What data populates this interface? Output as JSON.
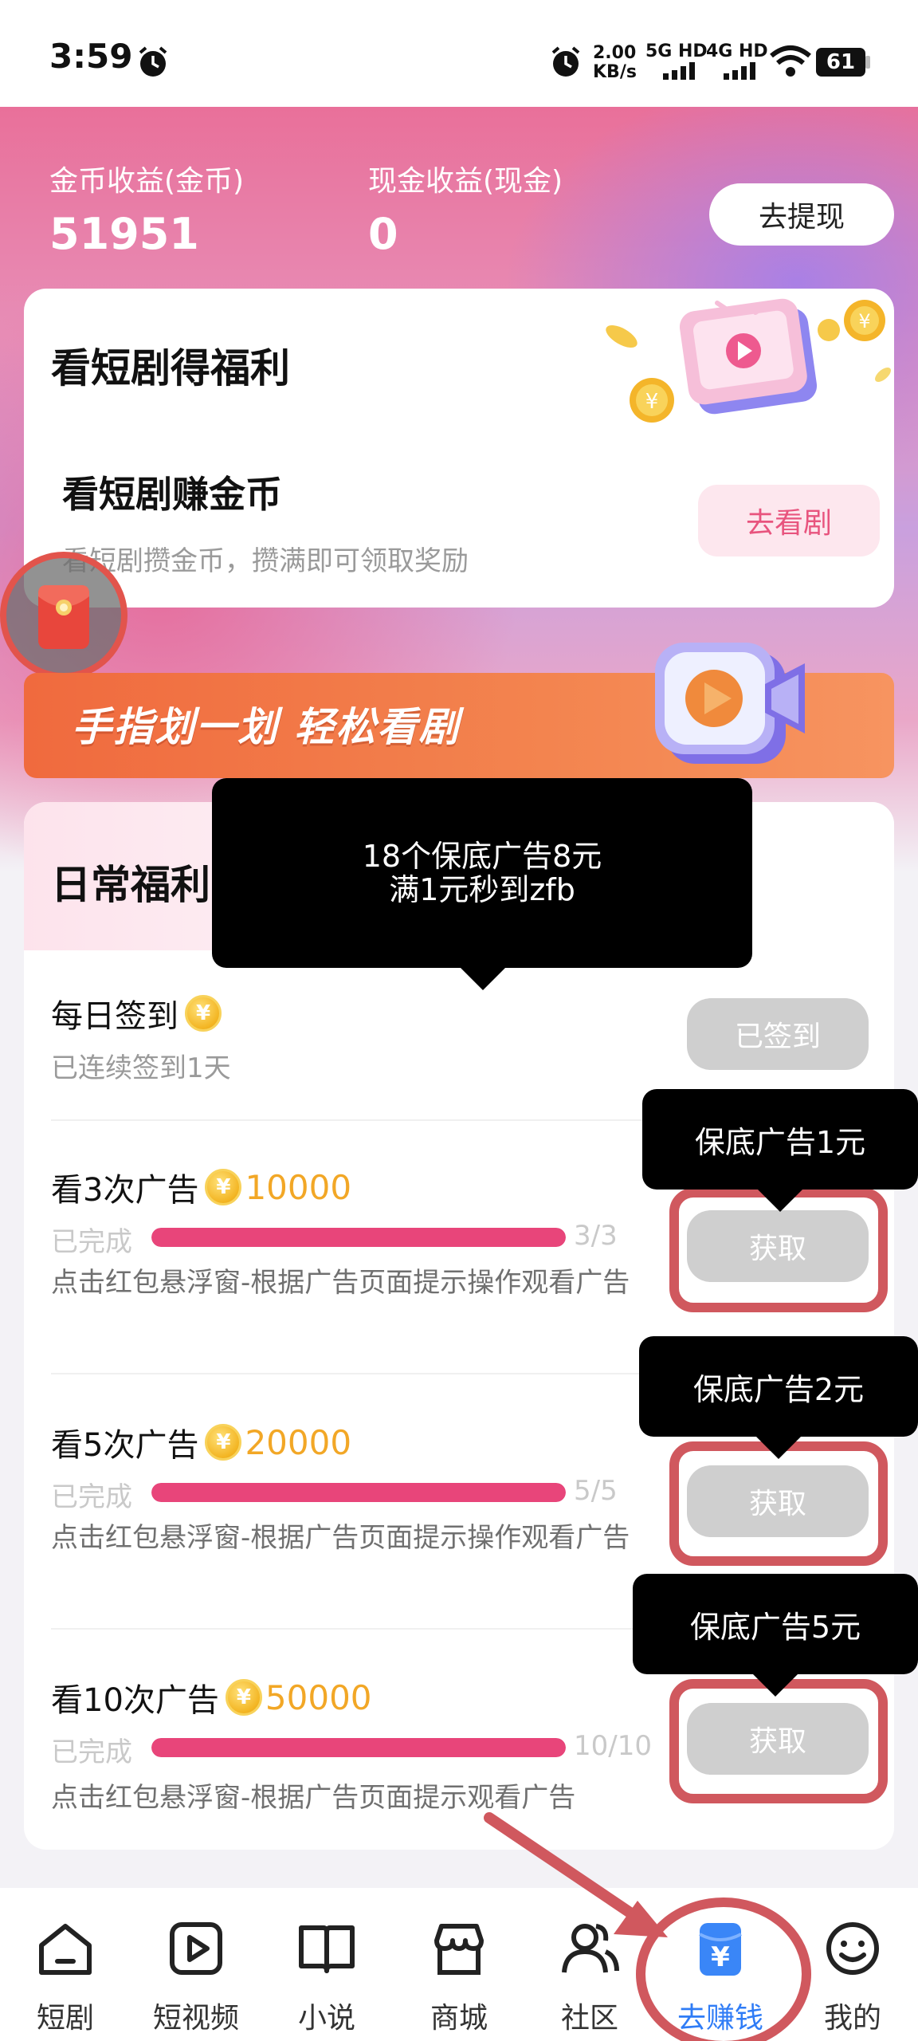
{
  "status_bar": {
    "time": "3:59",
    "net_speed_top": "2.00",
    "net_speed_unit": "KB/s",
    "sim1": "5G HD",
    "sim2": "4G HD",
    "battery": "61"
  },
  "earnings": {
    "coin_label": "金币收益(金币)",
    "coin_value": "51951",
    "cash_label": "现金收益(现金)",
    "cash_value": "0",
    "withdraw_button": "去提现"
  },
  "drama_card": {
    "title": "看短剧得福利",
    "task_title": "看短剧赚金币",
    "task_desc": "看短剧攒金币，攒满即可领取奖励",
    "watch_button": "去看剧"
  },
  "banner": {
    "text": "手指划一划 轻松看剧"
  },
  "tooltips": {
    "main_line1": "18个保底广告8元",
    "main_line2": "满1元秒到zfb",
    "ad1": "保底广告1元",
    "ad2": "保底广告2元",
    "ad3": "保底广告5元"
  },
  "daily": {
    "title": "日常福利",
    "checkin": {
      "title": "每日签到",
      "sub": "已连续签到1天",
      "button": "已签到"
    },
    "tasks": [
      {
        "title": "看3次广告",
        "reward": "10000",
        "status": "已完成",
        "progress": 1.0,
        "count": "3/3",
        "desc": "点击红包悬浮窗-根据广告页面提示操作观看广告",
        "button": "获取"
      },
      {
        "title": "看5次广告",
        "reward": "20000",
        "status": "已完成",
        "progress": 1.0,
        "count": "5/5",
        "desc": "点击红包悬浮窗-根据广告页面提示操作观看广告",
        "button": "获取"
      },
      {
        "title": "看10次广告",
        "reward": "50000",
        "status": "已完成",
        "progress": 1.0,
        "count": "10/10",
        "desc": "点击红包悬浮窗-根据广告页面提示观看广告",
        "button": "获取"
      }
    ]
  },
  "bottom_nav": [
    {
      "label": "短剧",
      "icon": "drama-home-icon",
      "active": false
    },
    {
      "label": "短视频",
      "icon": "play-icon",
      "active": false
    },
    {
      "label": "小说",
      "icon": "book-icon",
      "active": false
    },
    {
      "label": "商城",
      "icon": "store-icon",
      "active": false
    },
    {
      "label": "社区",
      "icon": "community-icon",
      "active": false
    },
    {
      "label": "去赚钱",
      "icon": "earn-money-icon",
      "active": true
    },
    {
      "label": "我的",
      "icon": "smiley-icon",
      "active": false
    }
  ],
  "colors": {
    "accent_pink": "#e8457a",
    "active_blue": "#2f7cf6",
    "annotation_red": "#d0585e",
    "coin_gold": "#f2a726"
  }
}
